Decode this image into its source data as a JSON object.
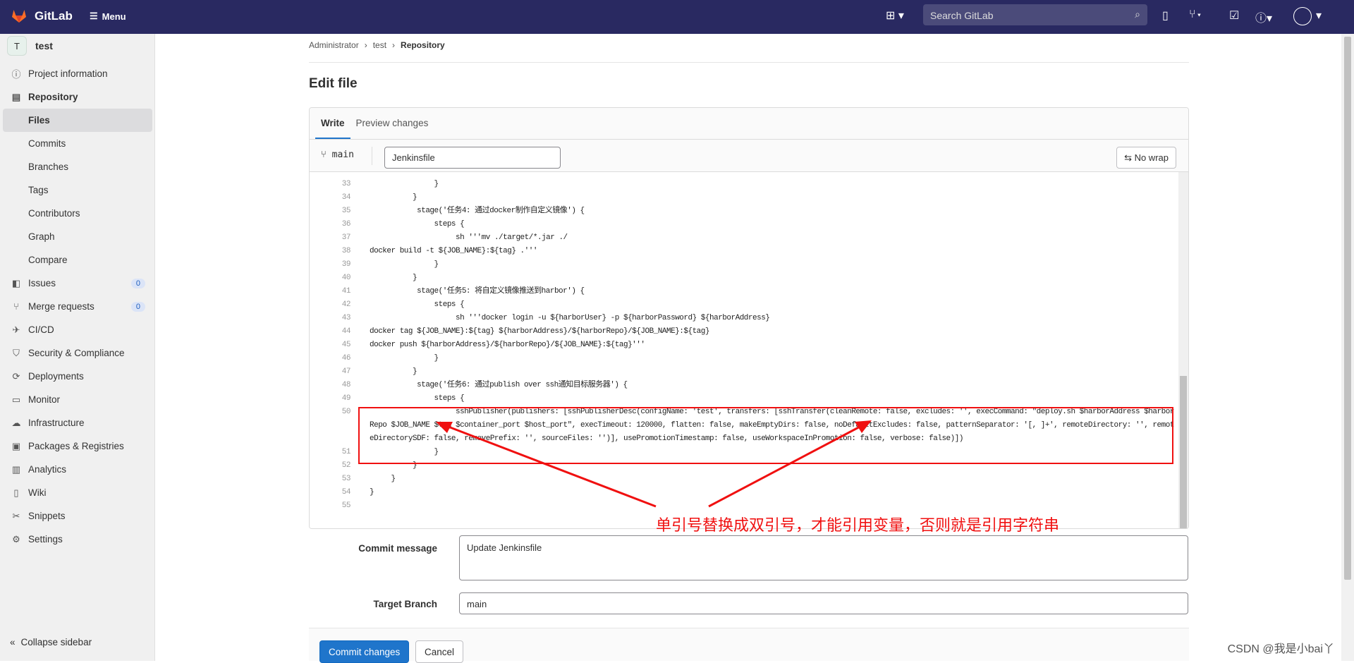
{
  "topbar": {
    "brand": "GitLab",
    "menu": "Menu",
    "search_placeholder": "Search GitLab"
  },
  "project": {
    "avatar": "T",
    "name": "test"
  },
  "sidebar": {
    "items": [
      {
        "label": "Project information",
        "icon": "info-icon",
        "g": "ⓘ"
      },
      {
        "label": "Repository",
        "icon": "book-icon",
        "g": "▤",
        "bold": true
      },
      {
        "label": "Files",
        "sub": true,
        "active": true
      },
      {
        "label": "Commits",
        "sub": true
      },
      {
        "label": "Branches",
        "sub": true
      },
      {
        "label": "Tags",
        "sub": true
      },
      {
        "label": "Contributors",
        "sub": true
      },
      {
        "label": "Graph",
        "sub": true
      },
      {
        "label": "Compare",
        "sub": true
      },
      {
        "label": "Issues",
        "icon": "issues-icon",
        "g": "◧",
        "badge": "0"
      },
      {
        "label": "Merge requests",
        "icon": "merge-request-icon",
        "g": "⑂",
        "badge": "0"
      },
      {
        "label": "CI/CD",
        "icon": "rocket-icon",
        "g": "✈"
      },
      {
        "label": "Security & Compliance",
        "icon": "shield-icon",
        "g": "⛉"
      },
      {
        "label": "Deployments",
        "icon": "deployments-icon",
        "g": "⟳"
      },
      {
        "label": "Monitor",
        "icon": "monitor-icon",
        "g": "▭"
      },
      {
        "label": "Infrastructure",
        "icon": "cloud-icon",
        "g": "☁"
      },
      {
        "label": "Packages & Registries",
        "icon": "package-icon",
        "g": "▣"
      },
      {
        "label": "Analytics",
        "icon": "chart-icon",
        "g": "▥"
      },
      {
        "label": "Wiki",
        "icon": "wiki-icon",
        "g": "▯"
      },
      {
        "label": "Snippets",
        "icon": "scissors-icon",
        "g": "✂"
      },
      {
        "label": "Settings",
        "icon": "gear-icon",
        "g": "⚙"
      }
    ],
    "collapse": "Collapse sidebar"
  },
  "breadcrumb": [
    "Administrator",
    "test",
    "Repository"
  ],
  "title": "Edit file",
  "editor": {
    "tabs": [
      "Write",
      "Preview changes"
    ],
    "branch": "main",
    "filename": "Jenkinsfile",
    "nowrap": "No wrap",
    "lines": [
      {
        "n": "33",
        "t": "               }"
      },
      {
        "n": "34",
        "t": "          }"
      },
      {
        "n": "35",
        "t": "           stage('任务4: 通过docker制作自定义镜像') {"
      },
      {
        "n": "36",
        "t": "               steps {"
      },
      {
        "n": "37",
        "t": "                    sh '''mv ./target/*.jar ./"
      },
      {
        "n": "38",
        "t": "docker build -t ${JOB_NAME}:${tag} .'''"
      },
      {
        "n": "39",
        "t": "               }"
      },
      {
        "n": "40",
        "t": "          }"
      },
      {
        "n": "41",
        "t": "           stage('任务5: 将自定义镜像推送到harbor') {"
      },
      {
        "n": "42",
        "t": "               steps {"
      },
      {
        "n": "43",
        "t": "                    sh '''docker login -u ${harborUser} -p ${harborPassword} ${harborAddress}"
      },
      {
        "n": "44",
        "t": "docker tag ${JOB_NAME}:${tag} ${harborAddress}/${harborRepo}/${JOB_NAME}:${tag}"
      },
      {
        "n": "45",
        "t": "docker push ${harborAddress}/${harborRepo}/${JOB_NAME}:${tag}'''"
      },
      {
        "n": "46",
        "t": "               }"
      },
      {
        "n": "47",
        "t": "          }"
      },
      {
        "n": "48",
        "t": "           stage('任务6: 通过publish over ssh通知目标服务器') {"
      },
      {
        "n": "49",
        "t": "               steps {"
      },
      {
        "n": "50",
        "t": "                    sshPublisher(publishers: [sshPublisherDesc(configName: 'test', transfers: [sshTransfer(cleanRemote: false, excludes: '', execCommand: \"deploy.sh $harborAddress $harborRepo $JOB_NAME $tag $container_port $host_port\", execTimeout: 120000, flatten: false, makeEmptyDirs: false, noDefaultExcludes: false, patternSeparator: '[, ]+', remoteDirectory: '', remoteDirectorySDF: false, removePrefix: '', sourceFiles: '')], usePromotionTimestamp: false, useWorkspaceInPromotion: false, verbose: false)])"
      },
      {
        "n": "51",
        "t": "               }"
      },
      {
        "n": "52",
        "t": "          }"
      },
      {
        "n": "53",
        "t": "     }"
      },
      {
        "n": "54",
        "t": "}"
      },
      {
        "n": "55",
        "t": ""
      }
    ]
  },
  "annotation": {
    "text": "单引号替换成双引号，才能引用变量，否则就是引用字符串",
    "color": "#f01010"
  },
  "commit": {
    "label": "Commit message",
    "value": "Update Jenkinsfile",
    "branch_label": "Target Branch",
    "branch": "main",
    "submit": "Commit changes",
    "cancel": "Cancel"
  },
  "watermark": "CSDN @我是小bai丫",
  "colors": {
    "topbar": "#292961",
    "primary": "#1f75cb"
  }
}
